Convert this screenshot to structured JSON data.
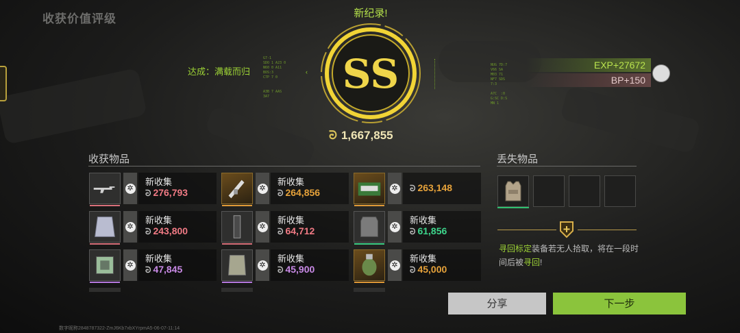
{
  "page_title": "收获价值评级",
  "achievement": "达成：满载而归",
  "record_label": "新纪录!",
  "rating": "SS",
  "total_value": "1,667,855",
  "exp": "EXP+27672",
  "bp": "BP+150",
  "collected_title": "收获物品",
  "lost_title": "丢失物品",
  "items": [
    {
      "label": "新收集",
      "value": "276,793",
      "color": "#f07a84",
      "bar": "#d9707a",
      "icon": "rifle-icon"
    },
    {
      "label": "新收集",
      "value": "264,856",
      "color": "#e6a23a",
      "bar": "#e19a36",
      "icon": "launcher-icon"
    },
    {
      "label": "",
      "value": "263,148",
      "color": "#e6a23a",
      "bar": "#e19a36",
      "icon": "ammo-box-icon"
    },
    {
      "label": "新收集",
      "value": "243,800",
      "color": "#f07a84",
      "bar": "#d9707a",
      "icon": "armor-plate-icon"
    },
    {
      "label": "新收集",
      "value": "64,712",
      "color": "#f07a84",
      "bar": "#d9707a",
      "icon": "magazine-icon"
    },
    {
      "label": "新收集",
      "value": "61,856",
      "color": "#3dd68c",
      "bar": "#3dcf86",
      "icon": "vest-icon"
    },
    {
      "label": "新收集",
      "value": "47,845",
      "color": "#c98ae6",
      "bar": "#b77ae0",
      "icon": "chip-icon"
    },
    {
      "label": "新收集",
      "value": "45,900",
      "color": "#c98ae6",
      "bar": "#b77ae0",
      "icon": "ceramic-plate-icon"
    },
    {
      "label": "新收集",
      "value": "45,000",
      "color": "#e6a23a",
      "bar": "#e19a36",
      "icon": "grenade-icon"
    }
  ],
  "note_highlight": "寻回标定",
  "note_text_1": "装备若无人拾取，将在一段时间后被",
  "note_highlight_2": "寻回",
  "note_text_2": "!",
  "share_button": "分享",
  "next_button": "下一步",
  "footer_text": "数字昵称2848787322-ZmJ6Kb7xbXYrpmA5-06-07-11:14",
  "hud_left_1": "G7-1\nSDO 1 A23 0\nN60 0 A11\nBOS:3\nC7P 7 0\n\n\nA3B 7 AAS\n3A7",
  "hud_right_1": "NUG 7D:7\nV66 SA\nM03 71\nNF7 SDS\n7:3\n\nA7C  :0\nG:SC D:S\nMN 1"
}
